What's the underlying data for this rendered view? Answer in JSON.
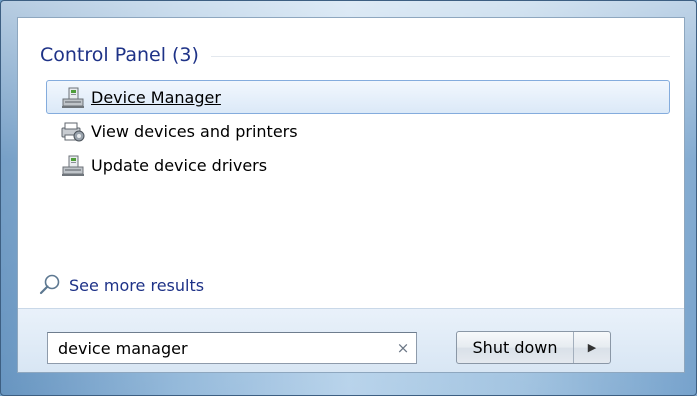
{
  "control_panel": {
    "title": "Control Panel (3)",
    "results": [
      {
        "label": "Device Manager",
        "icon": "device-manager-icon",
        "selected": true
      },
      {
        "label": "View devices and printers",
        "icon": "devices-printers-icon",
        "selected": false
      },
      {
        "label": "Update device drivers",
        "icon": "device-manager-icon",
        "selected": false
      }
    ]
  },
  "see_more": {
    "label": "See more results",
    "icon": "magnifier-icon"
  },
  "search": {
    "value": "device manager",
    "clear_icon": "×"
  },
  "shutdown": {
    "label": "Shut down",
    "arrow": "▶"
  },
  "colors": {
    "accent_text": "#1e3287",
    "selection_border": "#84acdd",
    "selection_fill": "#dbe9f8"
  }
}
